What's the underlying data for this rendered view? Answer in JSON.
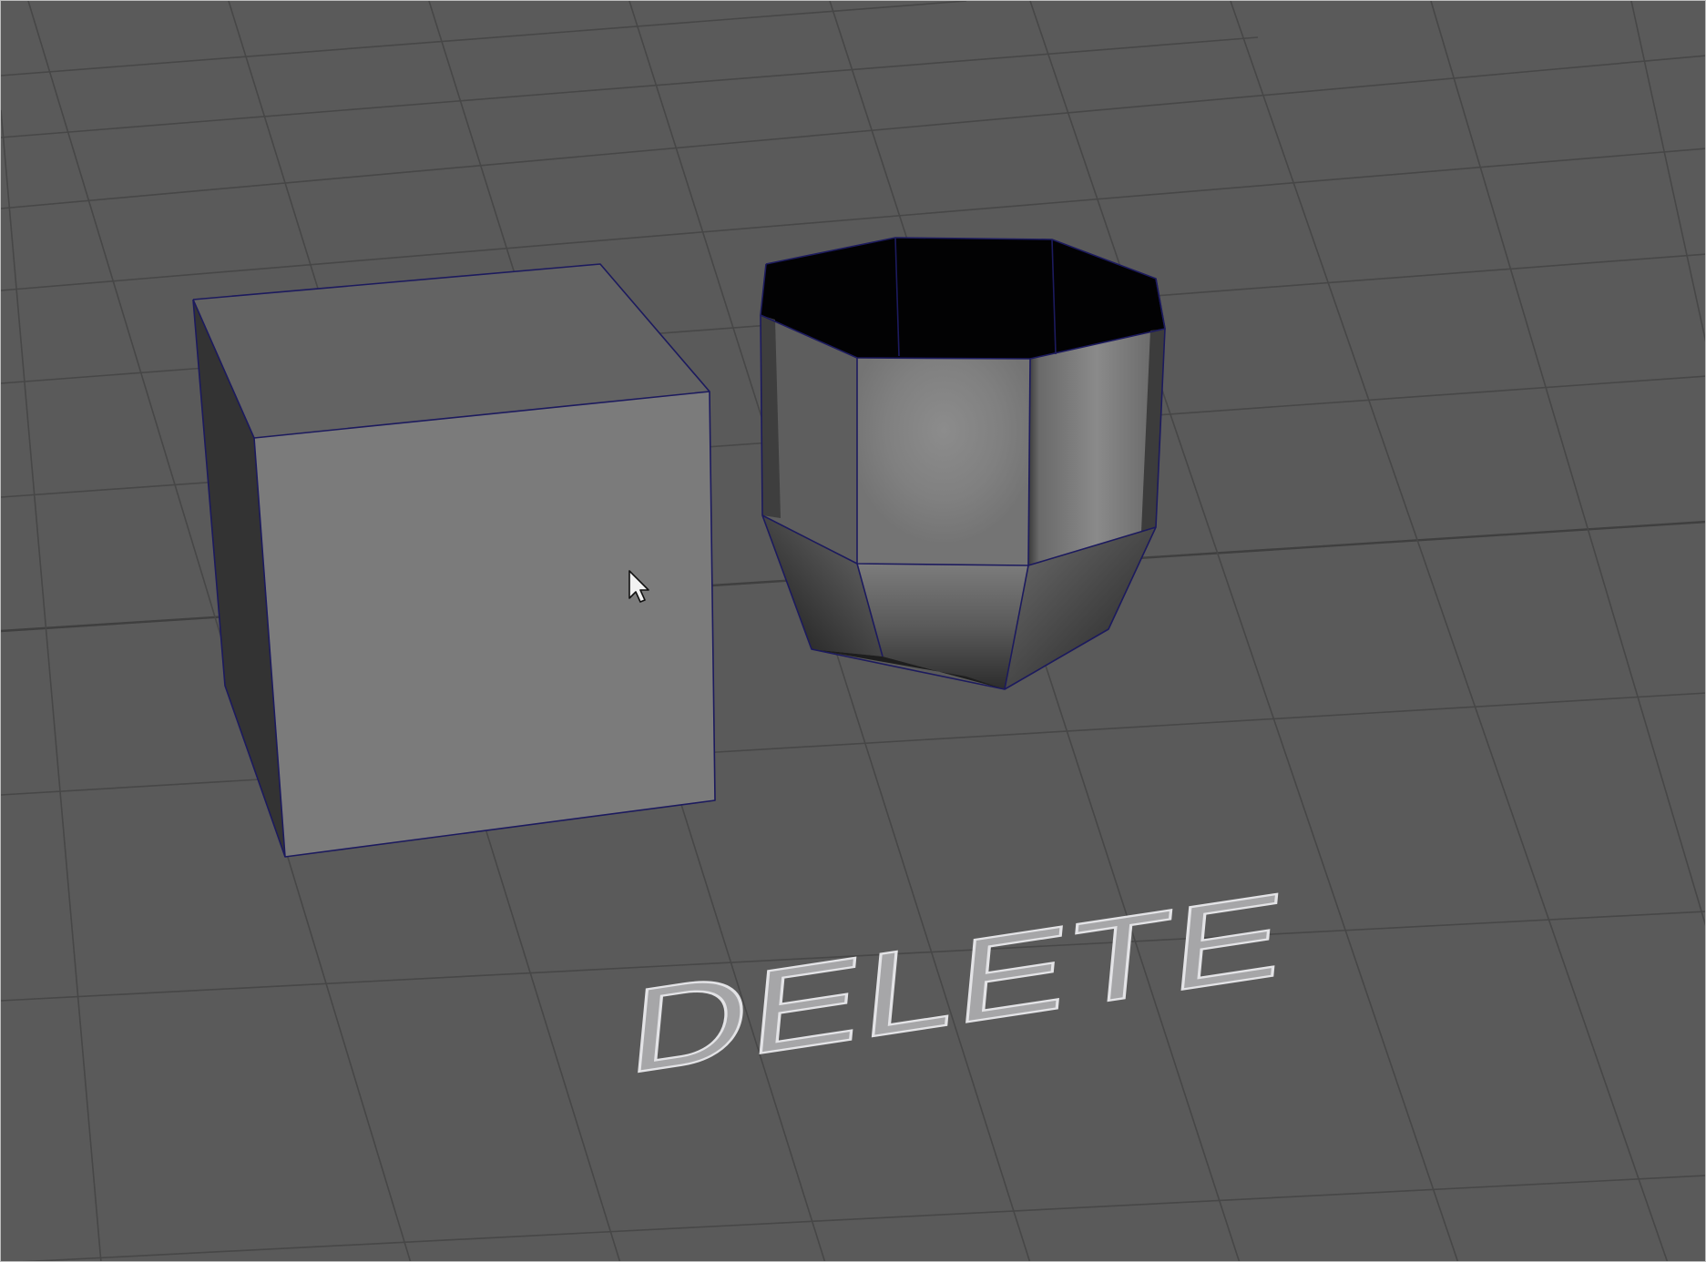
{
  "viewport": {
    "floor_label": "DELETE",
    "background_color": "#5a5a5a",
    "grid_color": "#474747",
    "wireframe_color": "#1c1a5e"
  },
  "objects": [
    {
      "name": "cube",
      "shape": "cube"
    },
    {
      "name": "cup",
      "shape": "octagonal-cup"
    }
  ],
  "cursor": {
    "icon": "arrow-cursor-icon"
  }
}
